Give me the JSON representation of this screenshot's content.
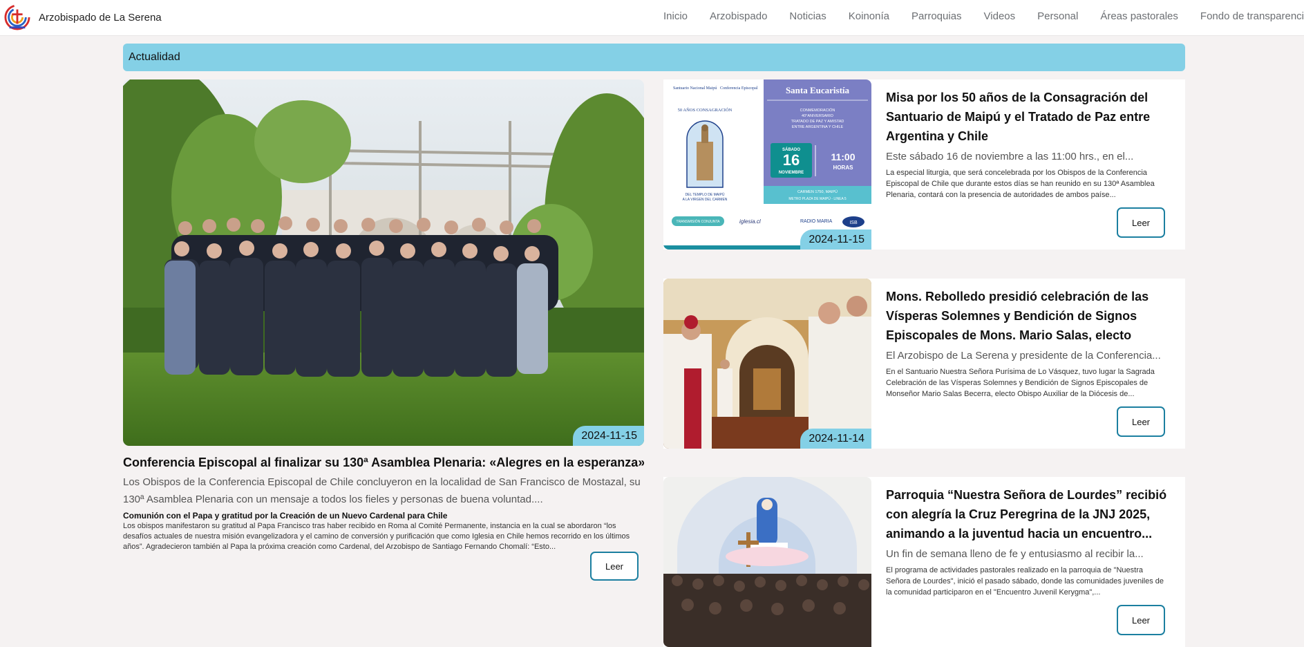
{
  "brand": {
    "name": "Arzobispado de La Serena",
    "logo_icon": "archdiocese-logo-icon"
  },
  "nav": {
    "items": [
      {
        "label": "Inicio"
      },
      {
        "label": "Arzobispado"
      },
      {
        "label": "Noticias"
      },
      {
        "label": "Koinonía"
      },
      {
        "label": "Parroquias"
      },
      {
        "label": "Videos"
      },
      {
        "label": "Personal"
      },
      {
        "label": "Áreas pastorales"
      },
      {
        "label": "Fondo de transparencia"
      }
    ]
  },
  "section": {
    "title": "Actualidad"
  },
  "colors": {
    "accent": "#84d0e6",
    "button_border": "#1b7fa0",
    "background": "#f5f2f2"
  },
  "featured": {
    "date": "2024-11-15",
    "title": "Conferencia Episcopal al finalizar su 130ª Asamblea Plenaria: «Alegres en la esperanza»",
    "summary": "Los Obispos de la Conferencia Episcopal de Chile concluyeron en la localidad de San Francisco de Mostazal, su 130ª Asamblea Plenaria con un mensaje a todos los fieles y personas de buena voluntad....",
    "subhead": "Comunión con el Papa y gratitud por la Creación de un Nuevo Cardenal para Chile",
    "body": "Los obispos manifestaron su gratitud al Papa Francisco tras haber recibido en Roma al Comité Permanente, instancia en la cual se abordaron “los desafíos actuales de nuestra misión evangelizadora y el camino de conversión y purificación que como Iglesia en Chile hemos recorrido en los últimos años”. Agradecieron también al Papa la próxima creación como Cardenal, del Arzobispo de Santiago Fernando Chomalí: “Esto...",
    "button": "Leer"
  },
  "cards": [
    {
      "date": "2024-11-15",
      "title": "Misa por los 50 años de la Consagración del Santuario de Maipú y el Tratado de Paz entre Argentina y Chile",
      "summary": "Este sábado 16 de noviembre a las 11:00 hrs., en el...",
      "body": "La especial liturgia, que será concelebrada por los Obispos de la Conferencia Episcopal de Chile que durante estos días se han reunido en su 130ª Asamblea Plenaria, contará con la presencia de autoridades de ambos paíse...",
      "button": "Leer",
      "poster": {
        "heading": "Santa Eucaristía",
        "sub1": "CONMEMORACIÓN",
        "sub2": "40°ANIVERSARIO",
        "sub3": "TRATADO DE PAZ Y AMISTAD",
        "sub4": "ENTRE ARGENTINA Y CHILE",
        "day_name": "SÁBADO",
        "day": "16",
        "month": "NOVIEMBRE",
        "time": "11:00",
        "time_unit": "HORAS",
        "address": "CARMEN 1750, MAIPÚ",
        "metro": "METRO PLAZA DE MAIPÚ - LINEA 5",
        "arc_text": "50 AÑOS CONSAGRACIÓN",
        "temple_caption_1": "DEL TEMPLO DE MAIPÚ",
        "temple_caption_2": "A LA VIRGEN DEL CARMEN",
        "org_1": "Santuario Nacional Maipú",
        "org_2": "Conferencia Episcopal",
        "transmision": "TRANSMISIÓN CONJUNTA",
        "logo_iglesia": "iglesia.cl",
        "logo_radio": "RADIO MARIA",
        "logo_isb": "ISB"
      }
    },
    {
      "date": "2024-11-14",
      "title": "Mons. Rebolledo presidió celebración de las Vísperas Solemnes y Bendición de Signos Episcopales de Mons. Mario Salas, electo Obis...",
      "summary": "El Arzobispo de La Serena y presidente de la Conferencia...",
      "body": "En el Santuario Nuestra Señora Purísima de Lo Vásquez, tuvo lugar la Sagrada Celebración de las Vísperas Solemnes y Bendición de Signos Episcopales de Monseñor Mario Salas Becerra, electo Obispo Auxiliar de la Diócesis de...",
      "button": "Leer"
    },
    {
      "date": "",
      "title": "Parroquia “Nuestra Señora de Lourdes” recibió con alegría la Cruz Peregrina de la JNJ 2025, animando a la juventud hacia un encuentro...",
      "summary": "Un fin de semana lleno de fe y entusiasmo al recibir la...",
      "body": "El programa de actividades pastorales realizado en la parroquia de \"Nuestra Señora de Lourdes\", inició el pasado sábado, donde las comunidades juveniles de la comunidad participaron en el \"Encuentro Juvenil Kerygma\",...",
      "button": "Leer"
    }
  ]
}
